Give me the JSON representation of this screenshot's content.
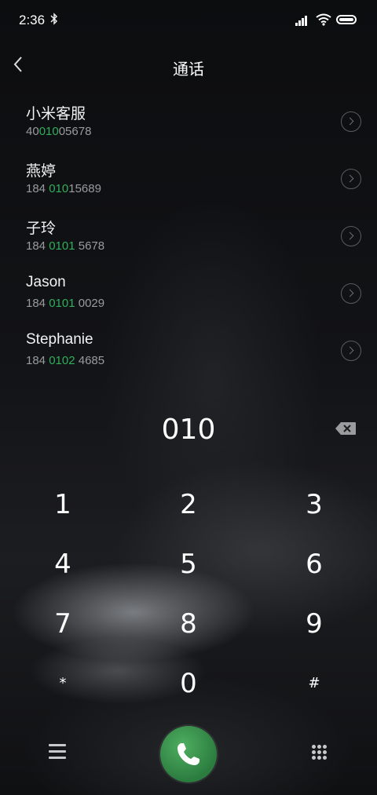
{
  "status_bar": {
    "time": "2:36",
    "bluetooth_icon": "bluetooth-icon",
    "signal_icon": "signal-icon",
    "wifi_icon": "wifi-icon",
    "battery_icon": "battery-icon"
  },
  "header": {
    "title": "通话",
    "back_icon": "chevron-left-icon"
  },
  "matches": [
    {
      "name": "小米客服",
      "number_prefix": "40",
      "number_match": "010",
      "number_suffix": "05678"
    },
    {
      "name": "燕婷",
      "number_prefix": "184 ",
      "number_match": "010",
      "number_suffix": "15689"
    },
    {
      "name": "子玲",
      "number_prefix": "184 ",
      "number_match": "0101",
      "number_suffix": " 5678"
    },
    {
      "name": "Jason",
      "number_prefix": "184 ",
      "number_match": "0101",
      "number_suffix": " 0029"
    },
    {
      "name": "Stephanie",
      "number_prefix": "184 ",
      "number_match": "0102",
      "number_suffix": " 4685"
    }
  ],
  "input": {
    "value": "010",
    "delete_icon": "backspace-icon"
  },
  "keypad": [
    "1",
    "2",
    "3",
    "4",
    "5",
    "6",
    "7",
    "8",
    "9",
    "*",
    "0",
    "#"
  ],
  "bottom_bar": {
    "menu_icon": "menu-icon",
    "call_icon": "phone-icon",
    "keypad_icon": "dialpad-icon"
  },
  "colors": {
    "match_highlight": "#2fae5c",
    "call_button": "#3a9a4c"
  }
}
